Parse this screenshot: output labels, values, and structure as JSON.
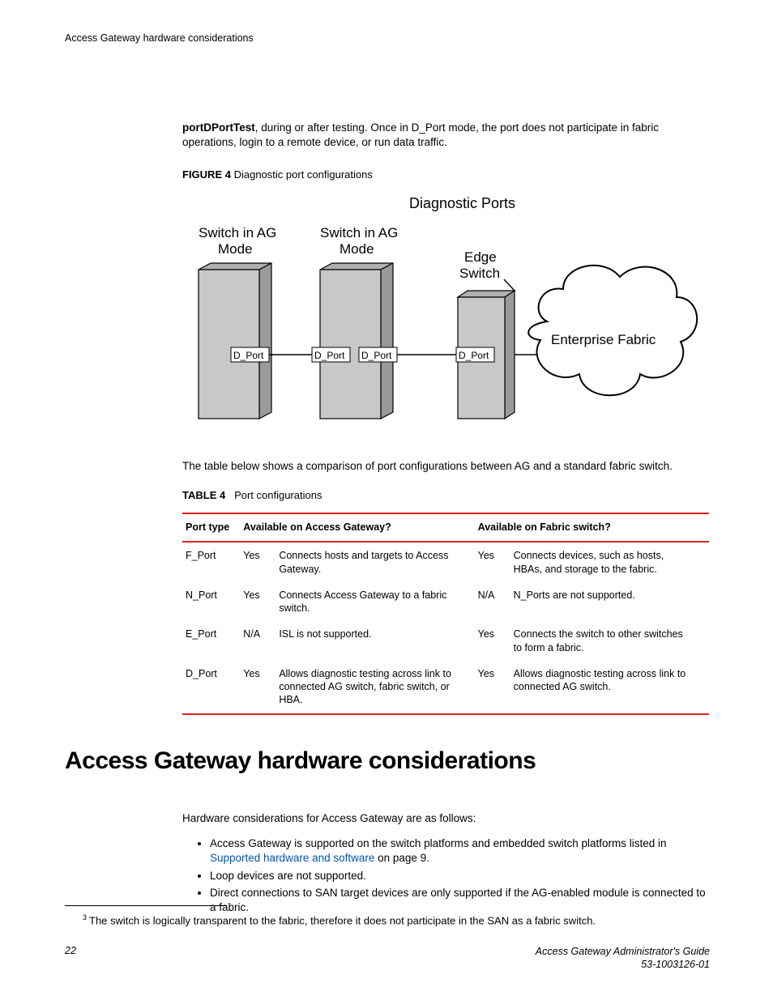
{
  "header": {
    "running": "Access Gateway hardware considerations"
  },
  "intro": {
    "bold": "portDPortTest",
    "rest": ", during or after testing. Once in D_Port mode, the port does not participate in fabric operations, login to a remote device, or run data traffic."
  },
  "figure": {
    "label": "FIGURE 4",
    "caption": "Diagnostic port configurations",
    "diagram": {
      "title": "Diagnostic Ports",
      "box1_l1": "Switch in AG",
      "box1_l2": "Mode",
      "box2_l1": "Switch in AG",
      "box2_l2": "Mode",
      "box3_l1": "Edge",
      "box3_l2": "Switch",
      "dport": "D_Port",
      "cloud": "Enterprise Fabric"
    }
  },
  "after_figure": "The table below shows a comparison of port configurations between AG and a standard fabric switch.",
  "table": {
    "label": "TABLE 4",
    "caption": "Port configurations",
    "headers": {
      "c1": "Port type",
      "c2": "Available on Access Gateway?",
      "c3": "Available on Fabric switch?"
    },
    "rows": [
      {
        "type": "F_Port",
        "ag_yn": "Yes",
        "ag_desc": "Connects hosts and targets to Access Gateway.",
        "fs_yn": "Yes",
        "fs_desc": "Connects devices, such as hosts, HBAs, and storage to the fabric."
      },
      {
        "type": "N_Port",
        "ag_yn": "Yes",
        "ag_desc": "Connects Access Gateway to a fabric switch.",
        "fs_yn": "N/A",
        "fs_desc": "N_Ports are not supported."
      },
      {
        "type": "E_Port",
        "ag_yn": "N/A",
        "ag_desc": "ISL is not supported.",
        "fs_yn": "Yes",
        "fs_desc": "Connects the switch to other switches to form a fabric."
      },
      {
        "type": "D_Port",
        "ag_yn": "Yes",
        "ag_desc": "Allows diagnostic testing across link to connected AG switch, fabric switch, or HBA.",
        "fs_yn": "Yes",
        "fs_desc": "Allows diagnostic testing across link to connected AG switch."
      }
    ]
  },
  "heading": "Access Gateway hardware considerations",
  "hw": {
    "intro": "Hardware considerations for Access Gateway are as follows:",
    "items": [
      {
        "pre": "Access Gateway is supported on the switch platforms and embedded switch platforms listed in ",
        "link": "Supported hardware and software",
        "post": " on page 9."
      },
      {
        "pre": "Loop devices are not supported."
      },
      {
        "pre": "Direct connections to SAN target devices are only supported if the AG-enabled module is connected to a fabric."
      }
    ]
  },
  "footnote": {
    "num": "3",
    "text": "The switch is logically transparent to the fabric, therefore it does not participate in the SAN as a fabric switch."
  },
  "footer": {
    "page": "22",
    "title": "Access Gateway Administrator's Guide",
    "docnum": "53-1003126-01"
  }
}
